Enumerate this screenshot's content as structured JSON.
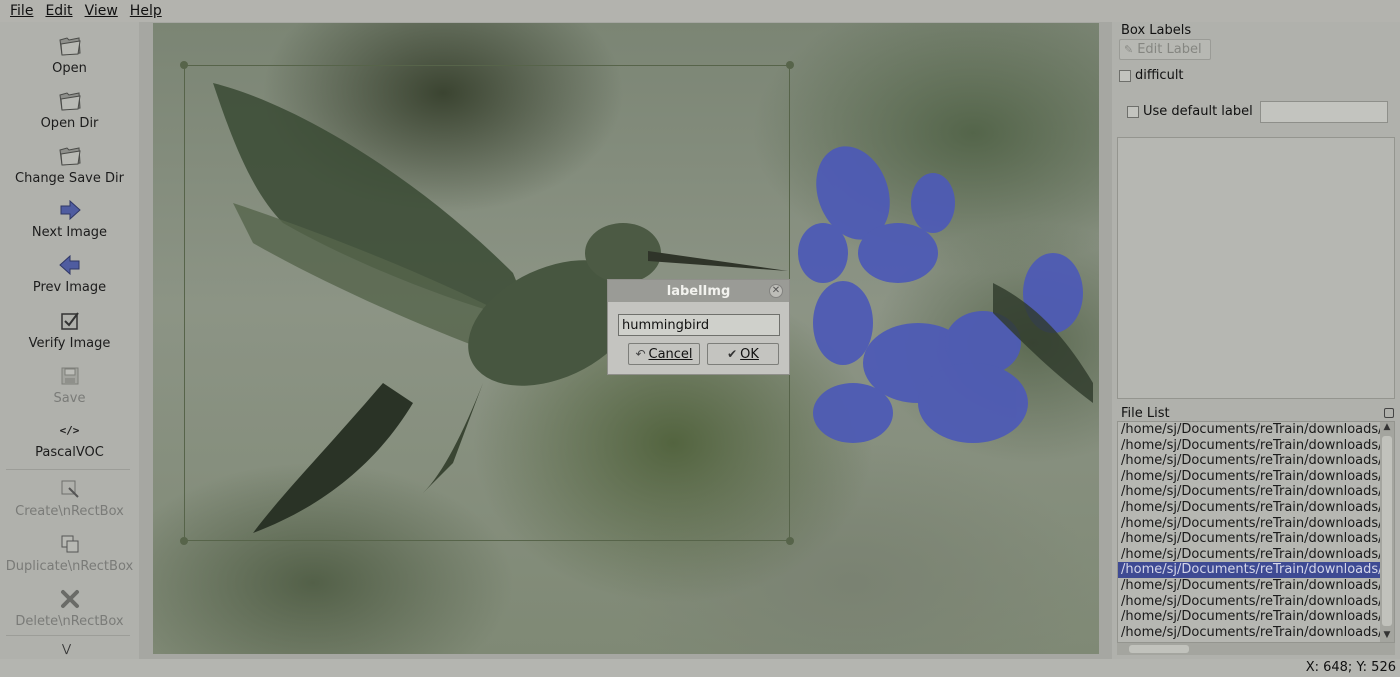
{
  "menu": {
    "items": [
      {
        "label": "File"
      },
      {
        "label": "Edit"
      },
      {
        "label": "View"
      },
      {
        "label": "Help"
      }
    ]
  },
  "toolbar": {
    "items": [
      {
        "label": "Open",
        "icon": "folder-open-icon",
        "enabled": true
      },
      {
        "label": "Open Dir",
        "icon": "folder-open-icon",
        "enabled": true
      },
      {
        "label": "Change Save Dir",
        "icon": "folder-open-icon",
        "enabled": true
      },
      {
        "label": "Next Image",
        "icon": "arrow-right-icon",
        "enabled": true
      },
      {
        "label": "Prev Image",
        "icon": "arrow-left-icon",
        "enabled": true
      },
      {
        "label": "Verify Image",
        "icon": "checkbox-icon",
        "enabled": true
      },
      {
        "label": "Save",
        "icon": "save-icon",
        "enabled": false
      },
      {
        "label": "PascalVOC",
        "icon": "code-icon",
        "enabled": true
      },
      {
        "label": "Create\\nRectBox",
        "icon": "create-rect-icon",
        "enabled": false
      },
      {
        "label": "Duplicate\\nRectBox",
        "icon": "duplicate-rect-icon",
        "enabled": false
      },
      {
        "label": "Delete\\nRectBox",
        "icon": "delete-icon",
        "enabled": false
      }
    ],
    "more_icon": "chevron-double-down-icon"
  },
  "dialog": {
    "title": "labelImg",
    "input_value": "hummingbird",
    "cancel_label": "Cancel",
    "ok_label": "OK"
  },
  "box_labels": {
    "title": "Box Labels",
    "edit_label": "Edit Label",
    "difficult_label": "difficult",
    "use_default_label": "Use default label",
    "default_label_value": ""
  },
  "file_list": {
    "title": "File List",
    "selected_index": 9,
    "files": [
      "/home/sj/Documents/reTrain/downloads/h",
      "/home/sj/Documents/reTrain/downloads/h",
      "/home/sj/Documents/reTrain/downloads/h",
      "/home/sj/Documents/reTrain/downloads/h",
      "/home/sj/Documents/reTrain/downloads/h",
      "/home/sj/Documents/reTrain/downloads/h",
      "/home/sj/Documents/reTrain/downloads/h",
      "/home/sj/Documents/reTrain/downloads/h",
      "/home/sj/Documents/reTrain/downloads/h",
      "/home/sj/Documents/reTrain/downloads/h",
      "/home/sj/Documents/reTrain/downloads/h",
      "/home/sj/Documents/reTrain/downloads/h",
      "/home/sj/Documents/reTrain/downloads/h",
      "/home/sj/Documents/reTrain/downloads/h"
    ]
  },
  "status": {
    "coords": "X: 648; Y: 526"
  },
  "colors": {
    "selection": "#3e4a93",
    "flower": "#4e5bb5",
    "bbox": "#57644a"
  }
}
